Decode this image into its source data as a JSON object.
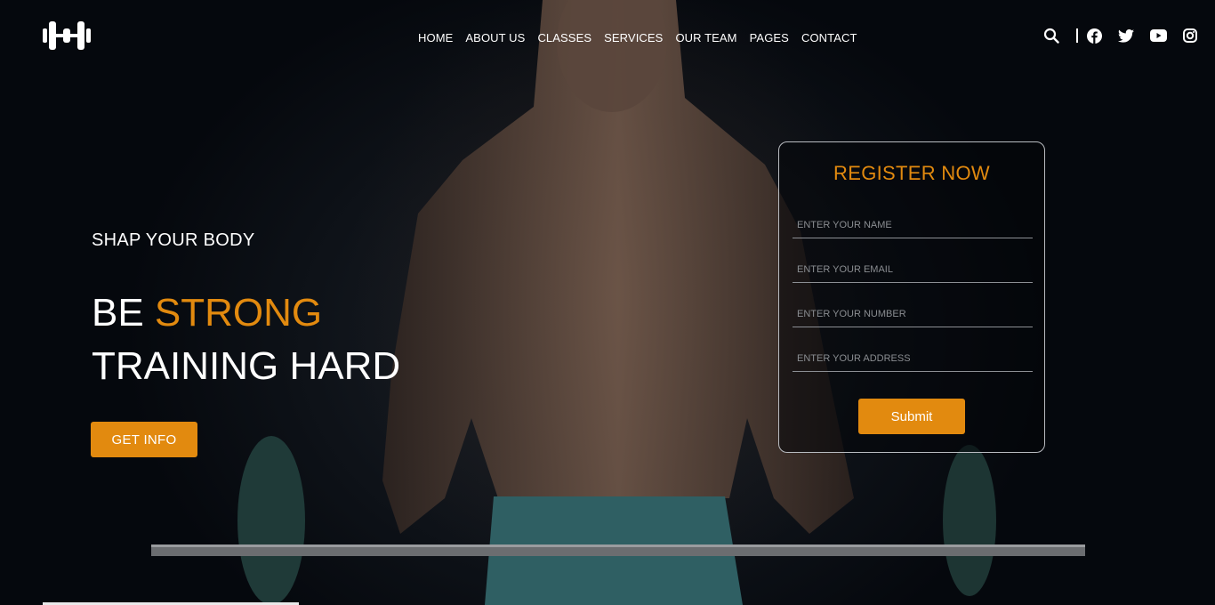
{
  "nav": {
    "items": [
      "HOME",
      "ABOUT US",
      "CLASSES",
      "SERVICES",
      "OUR TEAM",
      "PAGES",
      "CONTACT"
    ]
  },
  "icons": {
    "logo": "dumbbell-icon",
    "search": "search-icon",
    "social": [
      "facebook-icon",
      "twitter-icon",
      "youtube-icon",
      "instagram-icon"
    ]
  },
  "hero": {
    "subtitle": "SHAP YOUR BODY",
    "title_line1_prefix": "BE ",
    "title_line1_accent": "STRONG",
    "title_line2": "TRAINING HARD",
    "cta_label": "GET INFO"
  },
  "register": {
    "title": "REGISTER NOW",
    "name_placeholder": "ENTER YOUR NAME",
    "email_placeholder": "ENTER YOUR EMAIL",
    "number_placeholder": "ENTER YOUR NUMBER",
    "address_placeholder": "ENTER YOUR ADDRESS",
    "submit_label": "Submit"
  },
  "colors": {
    "accent": "#e28a0f",
    "background": "#05080d",
    "text": "#ffffff"
  }
}
